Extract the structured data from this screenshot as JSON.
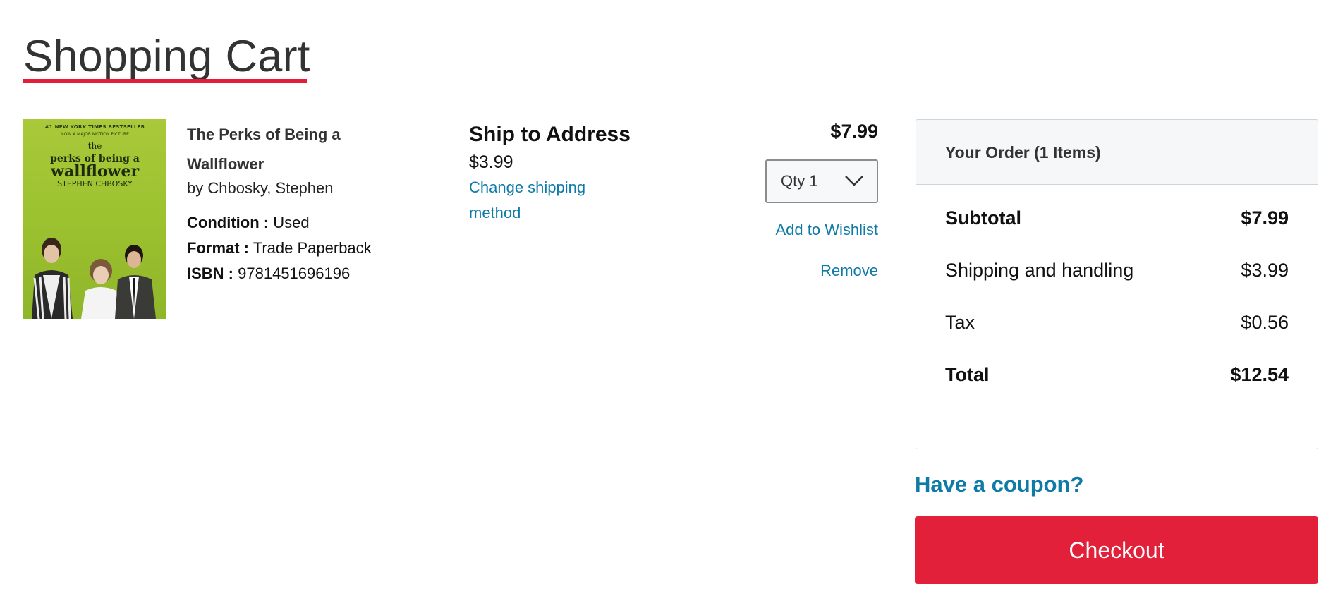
{
  "page": {
    "title": "Shopping Cart"
  },
  "item": {
    "cover": {
      "tagline": "#1 NEW YORK TIMES BESTSELLER",
      "subtag": "NOW A MAJOR MOTION PICTURE",
      "title_line1": "the",
      "title_line2": "perks of being a",
      "title_line3": "wallflower",
      "author": "STEPHEN CHBOSKY"
    },
    "title_line1": "The Perks of Being a",
    "title_line2": "Wallflower",
    "author": "by Chbosky, Stephen",
    "condition_label": "Condition :",
    "condition": "Used",
    "format_label": "Format :",
    "format": "Trade Paperback",
    "isbn_label": "ISBN :",
    "isbn": "9781451696196",
    "price": "$7.99",
    "qty_label": "Qty 1",
    "wishlist_label": "Add to Wishlist",
    "remove_label": "Remove"
  },
  "shipping": {
    "title": "Ship to Address",
    "price": "$3.99",
    "change_label": "Change shipping method"
  },
  "order": {
    "header": "Your Order (1 Items)",
    "rows": [
      {
        "label": "Subtotal",
        "value": "$7.99",
        "bold": true
      },
      {
        "label": "Shipping and handling",
        "value": "$3.99",
        "bold": false
      },
      {
        "label": "Tax",
        "value": "$0.56",
        "bold": false
      },
      {
        "label": "Total",
        "value": "$12.54",
        "bold": true
      }
    ]
  },
  "coupon_label": "Have a coupon?",
  "checkout_label": "Checkout",
  "colors": {
    "accent_red": "#e3203a",
    "link_blue": "#0e7aa8"
  },
  "icons": {
    "qty_dropdown": "chevron-down-icon"
  }
}
